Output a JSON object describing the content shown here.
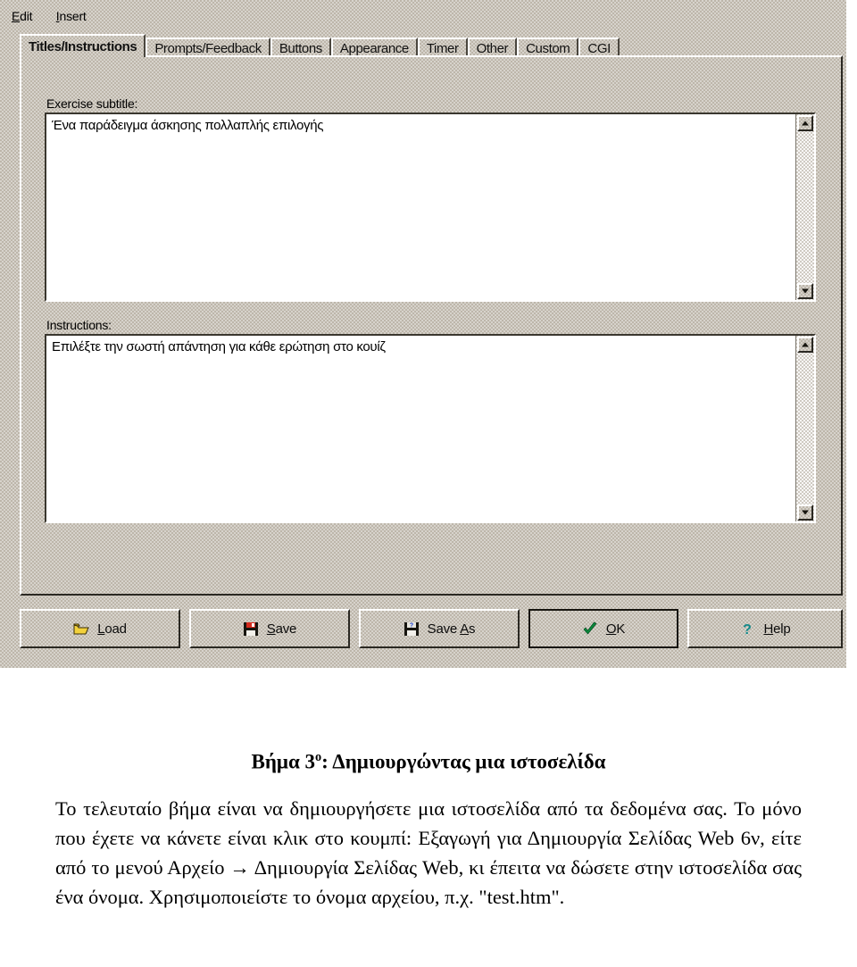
{
  "window": {
    "menu": [
      {
        "label": "Edit",
        "accel": "E"
      },
      {
        "label": "Insert",
        "accel": "I"
      }
    ],
    "tabs": [
      {
        "label": "Titles/Instructions",
        "selected": true
      },
      {
        "label": "Prompts/Feedback",
        "selected": false
      },
      {
        "label": "Buttons",
        "selected": false
      },
      {
        "label": "Appearance",
        "selected": false
      },
      {
        "label": "Timer",
        "selected": false
      },
      {
        "label": "Other",
        "selected": false
      },
      {
        "label": "Custom",
        "selected": false
      },
      {
        "label": "CGI",
        "selected": false
      }
    ],
    "fields": {
      "subtitle": {
        "label": "Exercise subtitle:",
        "value": "Ένα παράδειγμα άσκησης πολλαπλής επιλογής"
      },
      "instructions": {
        "label": "Instructions:",
        "value": "Επιλέξτε την σωστή απάντηση για κάθε ερώτηση στο κουίζ"
      }
    },
    "buttons": [
      {
        "label": "Load",
        "accel": "L",
        "icon": "open-folder-icon",
        "default": false
      },
      {
        "label": "Save",
        "accel": "S",
        "icon": "floppy-disk-icon",
        "default": false
      },
      {
        "label": "Save As",
        "accel": "A",
        "icon": "floppy-disk-question-icon",
        "default": false
      },
      {
        "label": "OK",
        "accel": "O",
        "icon": "green-check-icon",
        "default": true
      },
      {
        "label": "Help",
        "accel": "H",
        "icon": "question-mark-icon",
        "default": false
      }
    ],
    "colors": {
      "face": "#bdb6aa",
      "shadow": "#2a2822",
      "highlight": "#ffffff",
      "field_bg": "#ffffff",
      "folder_yellow": "#f2d13c",
      "floppy_red": "#d42b1e",
      "floppy_blue": "#1b3fd4",
      "check_green": "#0c8a3c",
      "help_teal": "#138a8a"
    }
  },
  "document": {
    "heading_prefix": "Βήμα 3",
    "heading_sup": "ο",
    "heading_suffix": ": Δημιουργώντας μια ιστοσελίδα",
    "paragraph": "Το τελευταίο βήμα είναι να δημιουργήσετε μια ιστοσελίδα από τα δεδομένα σας. Το μόνο που έχετε να κάνετε είναι κλικ στο κουμπί: Εξαγωγή για Δημιουργία Σελίδας Web 6ν, είτε από το μενού Αρχείο → Δημιουργία Σελίδας Web, κι έπειτα να δώσετε στην ιστοσελίδα σας ένα όνομα. Χρησιμοποιείστε το όνομα αρχείου, π.χ. \"test.htm\"."
  }
}
